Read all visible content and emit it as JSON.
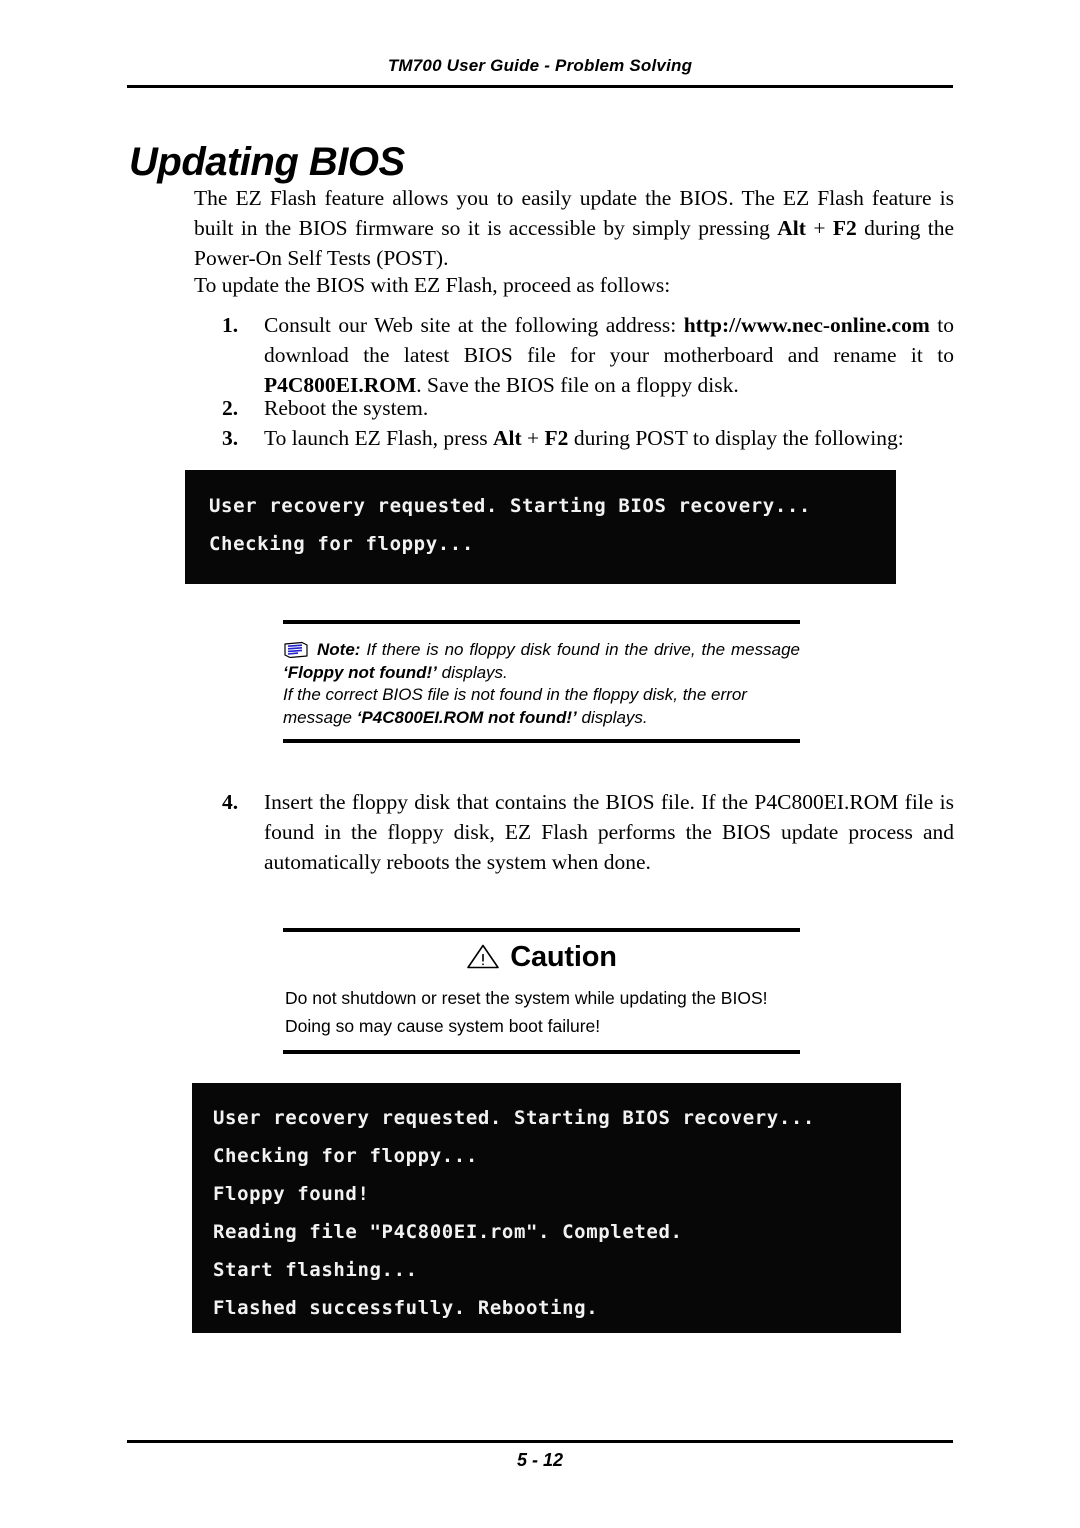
{
  "header": {
    "running_head": "TM700 User Guide - Problem Solving"
  },
  "title": "Updating BIOS",
  "intro": {
    "paragraph_1_part_1": "The EZ Flash feature allows you to easily update the BIOS. The EZ Flash feature is built in the BIOS firmware so it is accessible by simply pressing ",
    "paragraph_1_key_1": "Alt",
    "paragraph_1_plus": " + ",
    "paragraph_1_key_2": "F2",
    "paragraph_1_part_2": " during the Power-On Self Tests (POST).",
    "paragraph_2": "To update the BIOS with EZ Flash, proceed as follows:"
  },
  "steps": [
    {
      "number": "1.",
      "text_1": "Consult our Web site at the following address: ",
      "bold_1": "http://www.nec-online.com",
      "text_2": " to download the latest BIOS file for your motherboard and rename it to ",
      "bold_2": "P4C800EI.ROM",
      "text_3": ". Save the BIOS file on a floppy disk."
    },
    {
      "number": "2.",
      "text_1": "Reboot the system."
    },
    {
      "number": "3.",
      "text_1": "To launch EZ Flash, press ",
      "bold_1": "Alt",
      "text_2": " + ",
      "bold_2": "F2",
      "text_3": " during POST to display the following:"
    },
    {
      "number": "4.",
      "text_1": "Insert the floppy disk that contains the BIOS file. If the P4C800EI.ROM file is found in the floppy disk, EZ Flash performs the BIOS update process and automatically reboots the system when done."
    }
  ],
  "terminal_1": {
    "lines": [
      "User recovery requested. Starting BIOS recovery...",
      "Checking for floppy..."
    ]
  },
  "terminal_2": {
    "lines": [
      "User recovery requested. Starting BIOS recovery...",
      "Checking for floppy...",
      "Floppy found!",
      "Reading file \"P4C800EI.rom\". Completed.",
      "Start flashing...",
      "Flashed successfully. Rebooting."
    ]
  },
  "note": {
    "icon": "note-page-icon",
    "label": "Note:",
    "line_1_text_1": " If there is no floppy disk found in the drive, the message ",
    "line_1_bold": "‘Floppy not found!’",
    "line_1_text_2": " displays.",
    "line_2_text_1": "If the correct BIOS file is not found in the floppy disk, the error message ",
    "line_2_bold": "‘P4C800EI.ROM not found!’",
    "line_2_text_2": " displays."
  },
  "caution": {
    "icon": "warning-triangle-icon",
    "heading": "Caution",
    "line_1": "Do not shutdown or reset the system while updating the BIOS!",
    "line_2": "Doing so may cause system boot failure!"
  },
  "footer": {
    "page_number": "5 - 12"
  },
  "colors": {
    "terminal_background": "#070707",
    "terminal_text": "#f2f2f2",
    "note_icon_accent": "#2222cc",
    "rule": "#000000"
  }
}
